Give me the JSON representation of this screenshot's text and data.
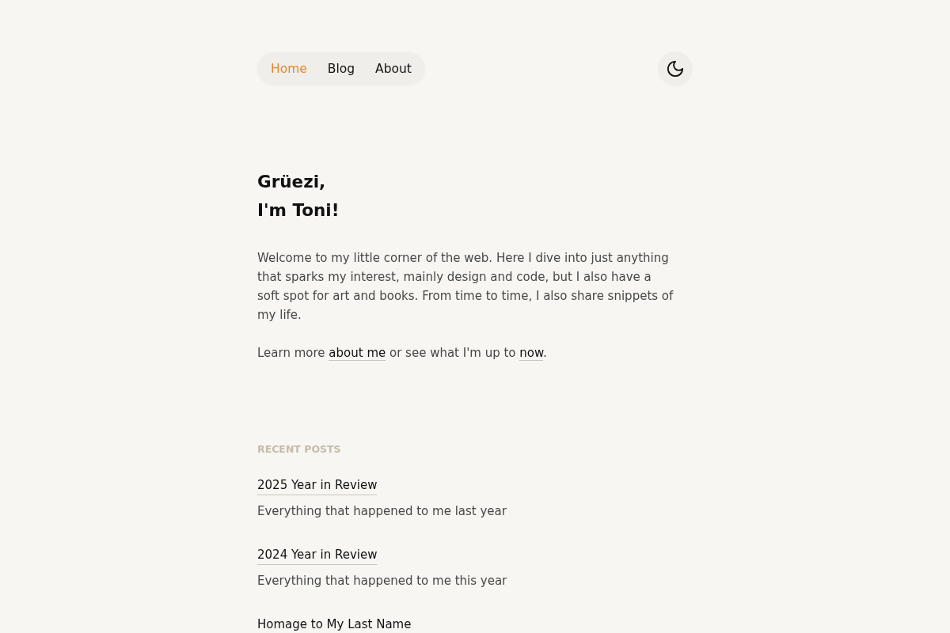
{
  "nav": {
    "links": [
      {
        "label": "Home",
        "selected": true
      },
      {
        "label": "Blog",
        "selected": false
      },
      {
        "label": "About",
        "selected": false
      }
    ]
  },
  "intro": {
    "greeting": [
      "Grüezi,",
      "I'm Toni!"
    ],
    "paragraph": "Welcome to my little corner of the web. Here I dive into just anything that sparks my interest, mainly design and code, but I also have a soft spot for art and books. From time to time, I also share snippets of my life.",
    "more": [
      {
        "kind": "text",
        "text": "Learn more "
      },
      {
        "kind": "link",
        "text": "about me"
      },
      {
        "kind": "text",
        "text": " or see what I'm up to "
      },
      {
        "kind": "link",
        "text": "now"
      },
      {
        "kind": "text",
        "text": "."
      }
    ]
  },
  "recent_posts": {
    "heading": "RECENT POSTS",
    "posts": [
      {
        "title": "2025 Year in Review",
        "description": "Everything that happened to me last year"
      },
      {
        "title": "2024 Year in Review",
        "description": "Everything that happened to me this year"
      },
      {
        "title": "Homage to My Last Name"
      }
    ]
  }
}
